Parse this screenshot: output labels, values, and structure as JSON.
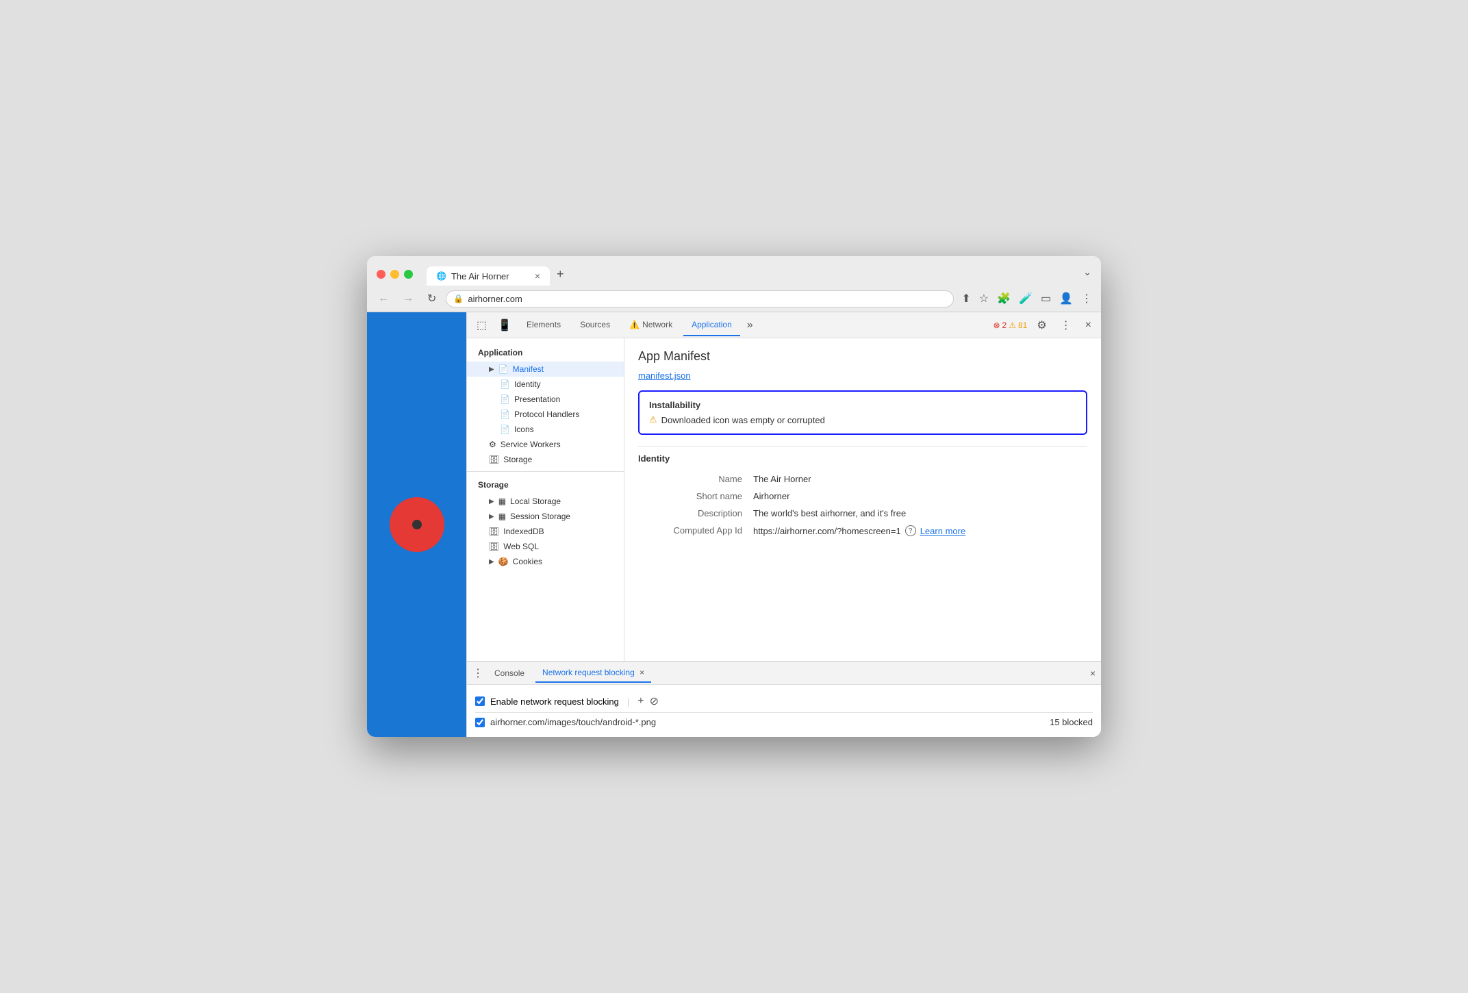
{
  "browser": {
    "tab_title": "The Air Horner",
    "tab_close": "×",
    "new_tab": "+",
    "chevron": "⌄",
    "address": "airhorner.com",
    "lock_icon": "🔒",
    "back": "←",
    "forward": "→",
    "refresh": "↻"
  },
  "devtools": {
    "tabs": [
      {
        "label": "Elements",
        "active": false
      },
      {
        "label": "Sources",
        "active": false
      },
      {
        "label": "Network",
        "active": false,
        "warning": true
      },
      {
        "label": "Application",
        "active": true
      }
    ],
    "more": "»",
    "errors": "2",
    "warnings": "81",
    "settings_icon": "⚙",
    "more_icon": "⋮",
    "close_icon": "×"
  },
  "sidebar": {
    "app_section": "Application",
    "items": [
      {
        "label": "Manifest",
        "indent": 1,
        "icon": "▶",
        "selected": true,
        "file_icon": "📄"
      },
      {
        "label": "Identity",
        "indent": 2,
        "file_icon": "📄"
      },
      {
        "label": "Presentation",
        "indent": 2,
        "file_icon": "📄"
      },
      {
        "label": "Protocol Handlers",
        "indent": 2,
        "file_icon": "📄"
      },
      {
        "label": "Icons",
        "indent": 2,
        "file_icon": "📄"
      },
      {
        "label": "Service Workers",
        "indent": 1,
        "gear_icon": "⚙"
      },
      {
        "label": "Storage",
        "indent": 1,
        "db_icon": "🗄"
      }
    ],
    "storage_section": "Storage",
    "storage_items": [
      {
        "label": "Local Storage",
        "indent": 1,
        "arrow": "▶",
        "grid_icon": "▦"
      },
      {
        "label": "Session Storage",
        "indent": 1,
        "arrow": "▶",
        "grid_icon": "▦"
      },
      {
        "label": "IndexedDB",
        "indent": 1,
        "db_icon": "🗄"
      },
      {
        "label": "Web SQL",
        "indent": 1,
        "db_icon": "🗄"
      },
      {
        "label": "Cookies",
        "indent": 1,
        "arrow": "▶",
        "cookie_icon": "🍪"
      }
    ]
  },
  "main": {
    "title": "App Manifest",
    "manifest_link": "manifest.json",
    "installability": {
      "title": "Installability",
      "warning_icon": "⚠",
      "error": "Downloaded icon was empty or corrupted"
    },
    "identity": {
      "title": "Identity",
      "fields": [
        {
          "label": "Name",
          "value": "The Air Horner"
        },
        {
          "label": "Short name",
          "value": "Airhorner"
        },
        {
          "label": "Description",
          "value": "The world's best airhorner, and it's free"
        },
        {
          "label": "Computed App Id",
          "value": "https://airhorner.com/?homescreen=1",
          "has_link": true,
          "link_text": "Learn more"
        }
      ]
    }
  },
  "bottom_panel": {
    "dots": "⋮",
    "tabs": [
      {
        "label": "Console",
        "active": false
      },
      {
        "label": "Network request blocking",
        "active": true,
        "closeable": true
      }
    ],
    "close_icon": "×",
    "enable_label": "Enable network request blocking",
    "add_icon": "+",
    "block_icon": "⊘",
    "block_pattern": "airhorner.com/images/touch/android-*.png",
    "block_count": "15 blocked"
  },
  "colors": {
    "accent": "#1a73e8",
    "border_blue": "#1a1aff",
    "warning": "#f29900",
    "error_red": "#d93025",
    "page_bg": "#1976d2",
    "horn_red": "#e53935"
  }
}
